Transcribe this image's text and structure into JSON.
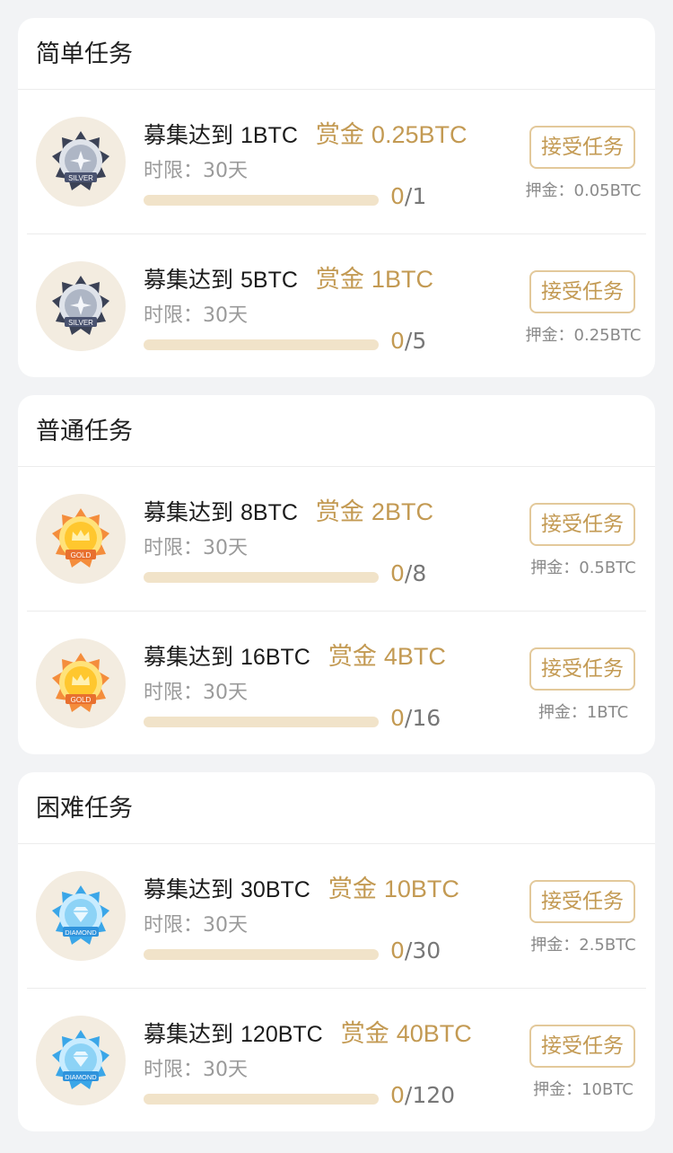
{
  "sections": [
    {
      "title": "简单任务",
      "tasks": [
        {
          "medal_label": "SILVER",
          "medal_icon": "silver-medal-icon",
          "goal_label": "募集达到",
          "goal_amount": "1BTC",
          "reward_label": "赏金",
          "reward_value": "0.25BTC",
          "limit_text": "时限：30天",
          "progress_current": "0",
          "progress_total": "/1",
          "progress_fraction": 0,
          "accept_label": "接受任务",
          "deposit_text": "押金：0.05BTC"
        },
        {
          "medal_label": "SILVER",
          "medal_icon": "silver-medal-icon",
          "goal_label": "募集达到",
          "goal_amount": "5BTC",
          "reward_label": "赏金",
          "reward_value": "1BTC",
          "limit_text": "时限：30天",
          "progress_current": "0",
          "progress_total": "/5",
          "progress_fraction": 0,
          "accept_label": "接受任务",
          "deposit_text": "押金：0.25BTC"
        }
      ]
    },
    {
      "title": "普通任务",
      "tasks": [
        {
          "medal_label": "GOLD",
          "medal_icon": "gold-medal-icon",
          "goal_label": "募集达到",
          "goal_amount": "8BTC",
          "reward_label": "赏金",
          "reward_value": "2BTC",
          "limit_text": "时限：30天",
          "progress_current": "0",
          "progress_total": "/8",
          "progress_fraction": 0,
          "accept_label": "接受任务",
          "deposit_text": "押金：0.5BTC"
        },
        {
          "medal_label": "GOLD",
          "medal_icon": "gold-medal-icon",
          "goal_label": "募集达到",
          "goal_amount": "16BTC",
          "reward_label": "赏金",
          "reward_value": "4BTC",
          "limit_text": "时限：30天",
          "progress_current": "0",
          "progress_total": "/16",
          "progress_fraction": 0,
          "accept_label": "接受任务",
          "deposit_text": "押金：1BTC"
        }
      ]
    },
    {
      "title": "困难任务",
      "tasks": [
        {
          "medal_label": "DIAMOND",
          "medal_icon": "diamond-medal-icon",
          "goal_label": "募集达到",
          "goal_amount": "30BTC",
          "reward_label": "赏金",
          "reward_value": "10BTC",
          "limit_text": "时限：30天",
          "progress_current": "0",
          "progress_total": "/30",
          "progress_fraction": 0,
          "accept_label": "接受任务",
          "deposit_text": "押金：2.5BTC"
        },
        {
          "medal_label": "DIAMOND",
          "medal_icon": "diamond-medal-icon",
          "goal_label": "募集达到",
          "goal_amount": "120BTC",
          "reward_label": "赏金",
          "reward_value": "40BTC",
          "limit_text": "时限：30天",
          "progress_current": "0",
          "progress_total": "/120",
          "progress_fraction": 0,
          "accept_label": "接受任务",
          "deposit_text": "押金：10BTC"
        }
      ]
    }
  ],
  "colors": {
    "accent": "#c39a53",
    "progress_track": "#f1e3c9",
    "page_background": "#f2f3f5",
    "silver": "#c9cfd9",
    "gold": "#ffc83a",
    "diamond": "#8dd3f6"
  }
}
